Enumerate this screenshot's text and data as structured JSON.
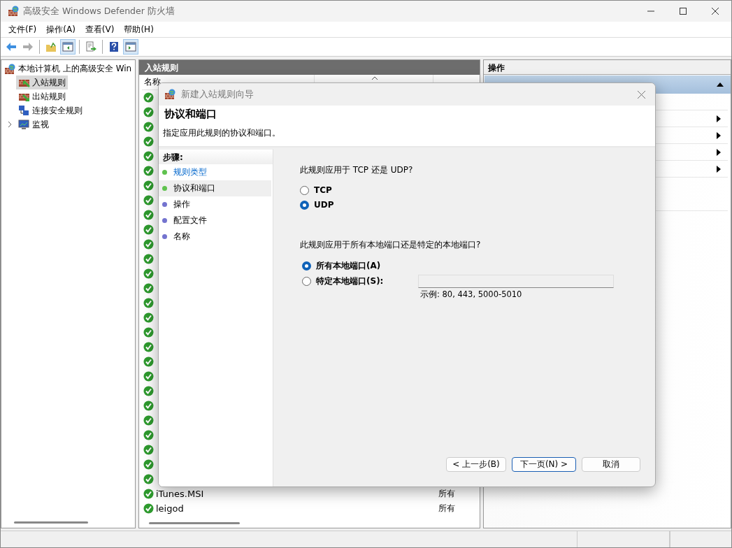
{
  "window": {
    "title": "高级安全 Windows Defender 防火墙"
  },
  "menu": [
    "文件(F)",
    "操作(A)",
    "查看(V)",
    "帮助(H)"
  ],
  "toolbar": [
    {
      "kind": "back",
      "on": false,
      "disabled": false
    },
    {
      "kind": "forward",
      "on": false,
      "disabled": true
    },
    {
      "kind": "sep"
    },
    {
      "kind": "up",
      "on": false,
      "disabled": false
    },
    {
      "kind": "tree",
      "on": true,
      "disabled": false
    },
    {
      "kind": "sep"
    },
    {
      "kind": "export",
      "on": false,
      "disabled": false
    },
    {
      "kind": "sep"
    },
    {
      "kind": "help",
      "on": false,
      "disabled": false
    },
    {
      "kind": "pane",
      "on": true,
      "disabled": false
    }
  ],
  "tree": {
    "label": "本地计算机 上的高级安全 Win",
    "children": [
      {
        "label": "入站规则",
        "kind": "inbound",
        "selected": true
      },
      {
        "label": "出站规则",
        "kind": "outbound",
        "selected": false
      },
      {
        "label": "连接安全规则",
        "kind": "connection",
        "selected": false
      },
      {
        "label": "监视",
        "kind": "monitor",
        "selected": false,
        "expanded": false
      }
    ]
  },
  "rules_panel": {
    "title": "入站规则",
    "columns": [
      "名称"
    ],
    "rows": [
      {
        "enabled": true
      },
      {
        "enabled": true
      },
      {
        "enabled": true
      },
      {
        "enabled": true
      },
      {
        "enabled": true
      },
      {
        "enabled": true
      },
      {
        "enabled": true
      },
      {
        "enabled": true
      },
      {
        "enabled": true
      },
      {
        "enabled": true
      },
      {
        "enabled": true
      },
      {
        "enabled": true
      },
      {
        "enabled": true
      },
      {
        "enabled": true
      },
      {
        "enabled": true
      },
      {
        "enabled": true
      },
      {
        "enabled": true
      },
      {
        "enabled": true
      },
      {
        "enabled": true
      },
      {
        "enabled": true
      },
      {
        "enabled": true
      },
      {
        "enabled": true
      },
      {
        "enabled": true
      },
      {
        "enabled": true
      },
      {
        "enabled": true
      },
      {
        "enabled": true
      },
      {
        "enabled": true
      },
      {
        "name": "iTunes.MSI",
        "profile": "所有",
        "enabled": true
      },
      {
        "name": "leigod",
        "profile": "所有",
        "enabled": true
      }
    ]
  },
  "actions_panel": {
    "title": "操作",
    "items": [
      {
        "kind": "section",
        "expanded": true
      },
      {
        "kind": "blank"
      },
      {
        "kind": "submenu"
      },
      {
        "kind": "submenu"
      },
      {
        "kind": "submenu"
      },
      {
        "kind": "submenu"
      },
      {
        "kind": "blank"
      }
    ]
  },
  "dialog": {
    "title": "新建入站规则向导",
    "heading": "协议和端口",
    "subtitle": "指定应用此规则的协议和端口。",
    "steps_title": "步骤:",
    "steps": [
      {
        "label": "规则类型",
        "kind": "link",
        "selected": false,
        "color": "#5fc24e"
      },
      {
        "label": "协议和端口",
        "kind": "text",
        "selected": true,
        "color": "#5fc24e"
      },
      {
        "label": "操作",
        "kind": "text",
        "selected": false,
        "color": "#7373cf"
      },
      {
        "label": "配置文件",
        "kind": "text",
        "selected": false,
        "color": "#7373cf"
      },
      {
        "label": "名称",
        "kind": "text",
        "selected": false,
        "color": "#7373cf"
      }
    ],
    "protocol_question": "此规则应用于 TCP 还是 UDP?",
    "protocols": [
      {
        "label": "TCP",
        "selected": false
      },
      {
        "label": "UDP",
        "selected": true
      }
    ],
    "port_question": "此规则应用于所有本地端口还是特定的本地端口?",
    "ports": [
      {
        "label": "所有本地端口(A)",
        "selected": true
      },
      {
        "label": "特定本地端口(S):",
        "selected": false
      }
    ],
    "port_field": {
      "disabled": true
    },
    "port_hint": "示例: 80, 443, 5000-5010",
    "buttons": [
      {
        "label": "< 上一步(B)",
        "default": false
      },
      {
        "label": "下一页(N) >",
        "default": true
      },
      {
        "label": "取消",
        "default": false
      }
    ]
  }
}
